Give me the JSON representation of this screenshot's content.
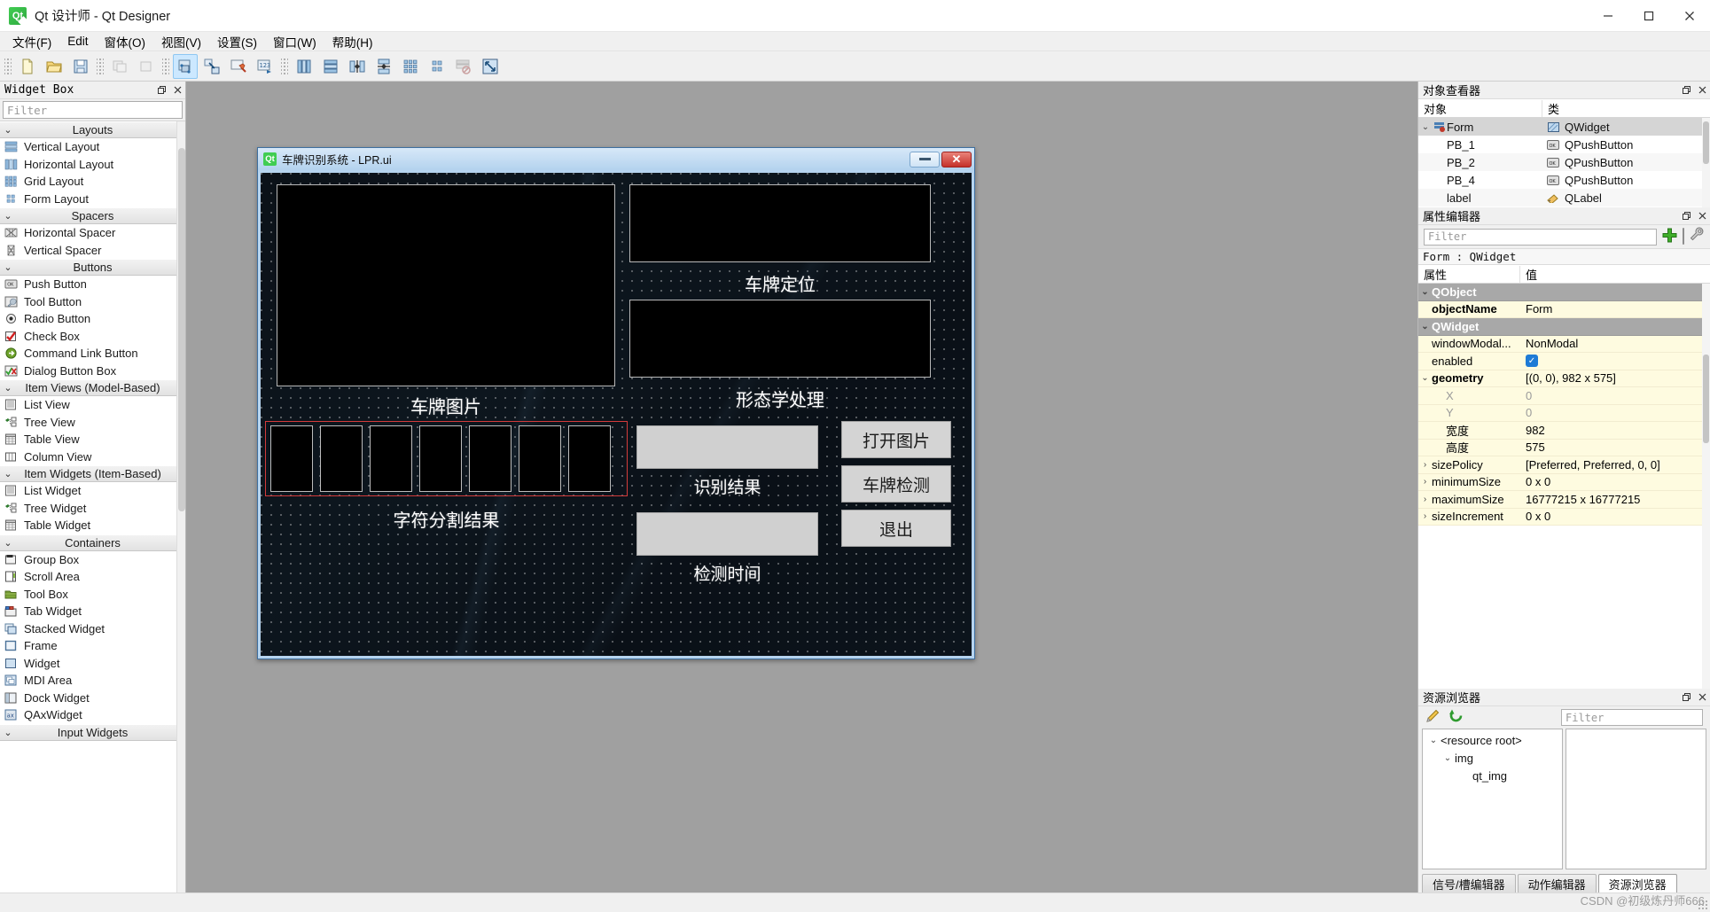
{
  "window": {
    "title": "Qt 设计师 - Qt Designer",
    "app_icon": "qt-logo-icon",
    "minimize": "minimize-icon",
    "maximize": "maximize-icon",
    "close": "close-icon"
  },
  "menubar": {
    "items": [
      {
        "label": "文件(F)",
        "mnemonic": "F"
      },
      {
        "label": "Edit",
        "mnemonic": "E"
      },
      {
        "label": "窗体(O)",
        "mnemonic": "O"
      },
      {
        "label": "视图(V)",
        "mnemonic": "V"
      },
      {
        "label": "设置(S)",
        "mnemonic": "S"
      },
      {
        "label": "窗口(W)",
        "mnemonic": "W"
      },
      {
        "label": "帮助(H)",
        "mnemonic": "H"
      }
    ]
  },
  "toolbar": {
    "groups": [
      {
        "buttons": [
          {
            "name": "new-form-icon",
            "enabled": true
          },
          {
            "name": "open-form-icon",
            "enabled": true
          },
          {
            "name": "save-form-icon",
            "enabled": true
          }
        ]
      },
      {
        "buttons": [
          {
            "name": "undo-icon",
            "enabled": false
          },
          {
            "name": "redo-icon",
            "enabled": false
          }
        ]
      },
      {
        "buttons": [
          {
            "name": "edit-widgets-icon",
            "enabled": true,
            "active": true
          },
          {
            "name": "edit-signals-slots-icon",
            "enabled": true
          },
          {
            "name": "edit-buddies-icon",
            "enabled": true
          },
          {
            "name": "edit-tab-order-icon",
            "enabled": true
          }
        ]
      },
      {
        "buttons": [
          {
            "name": "layout-horizontally-icon",
            "enabled": true
          },
          {
            "name": "layout-vertically-icon",
            "enabled": true
          },
          {
            "name": "layout-in-splitter-horizontal-icon",
            "enabled": true
          },
          {
            "name": "layout-in-splitter-vertical-icon",
            "enabled": true
          },
          {
            "name": "layout-in-grid-icon",
            "enabled": true
          },
          {
            "name": "layout-in-form-icon",
            "enabled": true
          },
          {
            "name": "break-layout-icon",
            "enabled": false
          },
          {
            "name": "adjust-size-icon",
            "enabled": true
          }
        ]
      }
    ]
  },
  "widget_box": {
    "panel_title": "Widget Box",
    "float_icon": "float-icon",
    "close_icon": "close-icon",
    "filter_placeholder": "Filter",
    "groups": [
      {
        "name": "Layouts",
        "expanded": true,
        "items": [
          {
            "label": "Vertical Layout",
            "icon": "vertical-layout-icon"
          },
          {
            "label": "Horizontal Layout",
            "icon": "horizontal-layout-icon"
          },
          {
            "label": "Grid Layout",
            "icon": "grid-layout-icon"
          },
          {
            "label": "Form Layout",
            "icon": "form-layout-icon"
          }
        ]
      },
      {
        "name": "Spacers",
        "expanded": true,
        "items": [
          {
            "label": "Horizontal Spacer",
            "icon": "horizontal-spacer-icon"
          },
          {
            "label": "Vertical Spacer",
            "icon": "vertical-spacer-icon"
          }
        ]
      },
      {
        "name": "Buttons",
        "expanded": true,
        "items": [
          {
            "label": "Push Button",
            "icon": "push-button-icon"
          },
          {
            "label": "Tool Button",
            "icon": "tool-button-icon"
          },
          {
            "label": "Radio Button",
            "icon": "radio-button-icon"
          },
          {
            "label": "Check Box",
            "icon": "check-box-icon"
          },
          {
            "label": "Command Link Button",
            "icon": "command-link-button-icon"
          },
          {
            "label": "Dialog Button Box",
            "icon": "dialog-button-box-icon"
          }
        ]
      },
      {
        "name": "Item Views (Model-Based)",
        "expanded": true,
        "items": [
          {
            "label": "List View",
            "icon": "list-view-icon"
          },
          {
            "label": "Tree View",
            "icon": "tree-view-icon"
          },
          {
            "label": "Table View",
            "icon": "table-view-icon"
          },
          {
            "label": "Column View",
            "icon": "column-view-icon"
          }
        ]
      },
      {
        "name": "Item Widgets (Item-Based)",
        "expanded": true,
        "items": [
          {
            "label": "List Widget",
            "icon": "list-widget-icon"
          },
          {
            "label": "Tree Widget",
            "icon": "tree-widget-icon"
          },
          {
            "label": "Table Widget",
            "icon": "table-widget-icon"
          }
        ]
      },
      {
        "name": "Containers",
        "expanded": true,
        "items": [
          {
            "label": "Group Box",
            "icon": "group-box-icon"
          },
          {
            "label": "Scroll Area",
            "icon": "scroll-area-icon"
          },
          {
            "label": "Tool Box",
            "icon": "tool-box-icon"
          },
          {
            "label": "Tab Widget",
            "icon": "tab-widget-icon"
          },
          {
            "label": "Stacked Widget",
            "icon": "stacked-widget-icon"
          },
          {
            "label": "Frame",
            "icon": "frame-icon"
          },
          {
            "label": "Widget",
            "icon": "widget-icon"
          },
          {
            "label": "MDI Area",
            "icon": "mdi-area-icon"
          },
          {
            "label": "Dock Widget",
            "icon": "dock-widget-icon"
          },
          {
            "label": "QAxWidget",
            "icon": "qaxwidget-icon"
          }
        ]
      },
      {
        "name": "Input Widgets",
        "expanded": true,
        "items": []
      }
    ]
  },
  "form": {
    "title": "车牌识别系统 - LPR.ui",
    "qt_badge": "Qt",
    "minimize_icon": "minimize-icon",
    "close_icon": "close-icon",
    "labels": {
      "plate_image": "车牌图片",
      "plate_location": "车牌定位",
      "morphology": "形态学处理",
      "char_segmentation": "字符分割结果",
      "recognition_result": "识别结果",
      "detection_time": "检测时间"
    },
    "buttons": {
      "open_image": "打开图片",
      "plate_detect": "车牌检测",
      "exit": "退出"
    },
    "segment_count": 7
  },
  "object_inspector": {
    "panel_title": "对象查看器",
    "float_icon": "float-icon",
    "close_icon": "close-icon",
    "columns": [
      "对象",
      "类"
    ],
    "rows": [
      {
        "object": "Form",
        "class": "QWidget",
        "icon": "qwidget-icon",
        "depth": 0,
        "selected": true,
        "expanded": true
      },
      {
        "object": "PB_1",
        "class": "QPushButton",
        "icon": "pushbutton-icon",
        "depth": 1,
        "selected": false
      },
      {
        "object": "PB_2",
        "class": "QPushButton",
        "icon": "pushbutton-icon",
        "depth": 1,
        "selected": false
      },
      {
        "object": "PB_4",
        "class": "QPushButton",
        "icon": "pushbutton-icon",
        "depth": 1,
        "selected": false
      },
      {
        "object": "label",
        "class": "QLabel",
        "icon": "qlabel-icon",
        "depth": 1,
        "selected": false
      }
    ]
  },
  "property_editor": {
    "panel_title": "属性编辑器",
    "float_icon": "float-icon",
    "close_icon": "close-icon",
    "filter_placeholder": "Filter",
    "add_icon": "plus-icon",
    "remove_icon": "minus-icon",
    "configure_icon": "wrench-icon",
    "object_line": "Form : QWidget",
    "columns": [
      "属性",
      "值"
    ],
    "rows": [
      {
        "kind": "group",
        "name": "QObject",
        "value": "",
        "expanded": true
      },
      {
        "kind": "prop",
        "name": "objectName",
        "value": "Form",
        "bold": true
      },
      {
        "kind": "group",
        "name": "QWidget",
        "value": "",
        "expanded": true
      },
      {
        "kind": "prop",
        "name": "windowModal...",
        "value": "NonModal"
      },
      {
        "kind": "checkprop",
        "name": "enabled",
        "value": "checked"
      },
      {
        "kind": "prop",
        "name": "geometry",
        "value": "[(0, 0), 982 x 575]",
        "bold": true,
        "expander": "v"
      },
      {
        "kind": "sub",
        "name": "X",
        "value": "0"
      },
      {
        "kind": "sub",
        "name": "Y",
        "value": "0"
      },
      {
        "kind": "sub2",
        "name": "宽度",
        "value": "982"
      },
      {
        "kind": "sub2",
        "name": "高度",
        "value": "575"
      },
      {
        "kind": "prop",
        "name": "sizePolicy",
        "value": "[Preferred, Preferred, 0, 0]",
        "expander": ">"
      },
      {
        "kind": "prop",
        "name": "minimumSize",
        "value": "0 x 0",
        "expander": ">"
      },
      {
        "kind": "prop",
        "name": "maximumSize",
        "value": "16777215 x 16777215",
        "expander": ">"
      },
      {
        "kind": "prop",
        "name": "sizeIncrement",
        "value": "0 x 0",
        "expander": ">"
      }
    ]
  },
  "resource_browser": {
    "panel_title": "资源浏览器",
    "float_icon": "float-icon",
    "close_icon": "close-icon",
    "edit_icon": "pencil-icon",
    "reload_icon": "reload-icon",
    "filter_placeholder": "Filter",
    "tree": [
      {
        "label": "<resource root>",
        "depth": 0,
        "expanded": true
      },
      {
        "label": "img",
        "depth": 1,
        "expanded": true
      },
      {
        "label": "qt_img",
        "depth": 2,
        "expanded": false
      }
    ],
    "tabs": [
      {
        "label": "信号/槽编辑器",
        "active": false
      },
      {
        "label": "动作编辑器",
        "active": false
      },
      {
        "label": "资源浏览器",
        "active": true
      }
    ]
  },
  "watermark": "CSDN @初级炼丹师666"
}
